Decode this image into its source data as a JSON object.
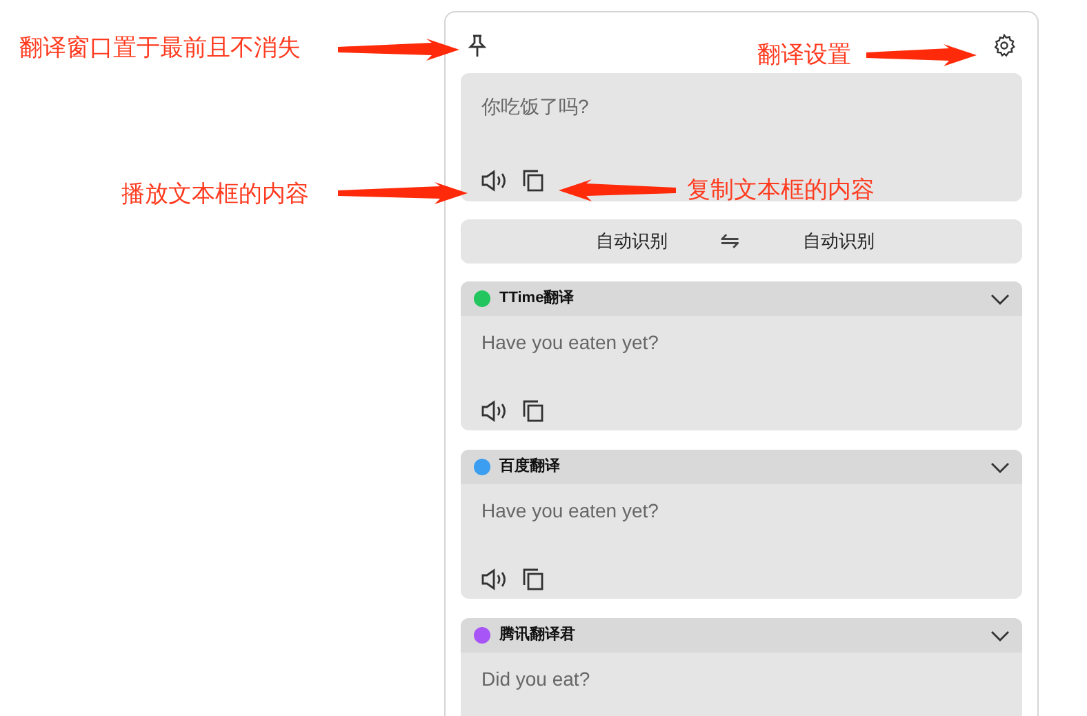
{
  "source": {
    "text": "你吃饭了吗?"
  },
  "language_bar": {
    "from": "自动识别",
    "swap": "⇋",
    "to": "自动识别"
  },
  "results": [
    {
      "service": "TTime翻译",
      "color": "#22c55e",
      "text": "Have you eaten yet?"
    },
    {
      "service": "百度翻译",
      "color": "#3b9ef0",
      "text": "Have you eaten yet?"
    },
    {
      "service": "腾讯翻译君",
      "color": "#a855f7",
      "text": "Did you eat?"
    }
  ],
  "annotations": [
    {
      "text": "翻译窗口置于最前且不消失"
    },
    {
      "text": "翻译设置"
    },
    {
      "text": "播放文本框的内容"
    },
    {
      "text": "复制文本框的内容"
    }
  ]
}
